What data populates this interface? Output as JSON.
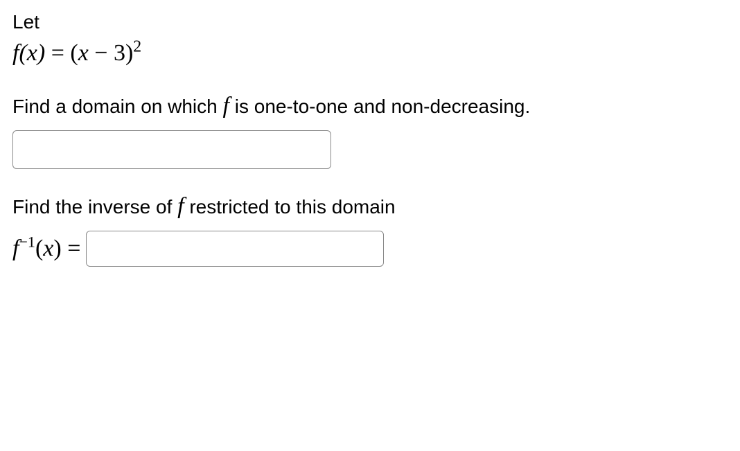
{
  "intro": {
    "let": "Let",
    "formula_lhs": "f(x)",
    "formula_eq": " = ",
    "formula_rhs_open": "(",
    "formula_rhs_x": "x",
    "formula_rhs_minus": " − 3)",
    "formula_rhs_exp": "2"
  },
  "question1": {
    "text_part1": "Find a domain on which ",
    "text_f": "f",
    "text_part2": " is one-to-one and non-decreasing.",
    "input_value": ""
  },
  "question2": {
    "text_part1": "Find the inverse of ",
    "text_f": "f",
    "text_part2": " restricted to this domain",
    "inverse_f": "f",
    "inverse_exp": "−1",
    "inverse_paren_open": "(",
    "inverse_x": "x",
    "inverse_paren_close": ")",
    "inverse_eq": " = ",
    "input_value": ""
  }
}
